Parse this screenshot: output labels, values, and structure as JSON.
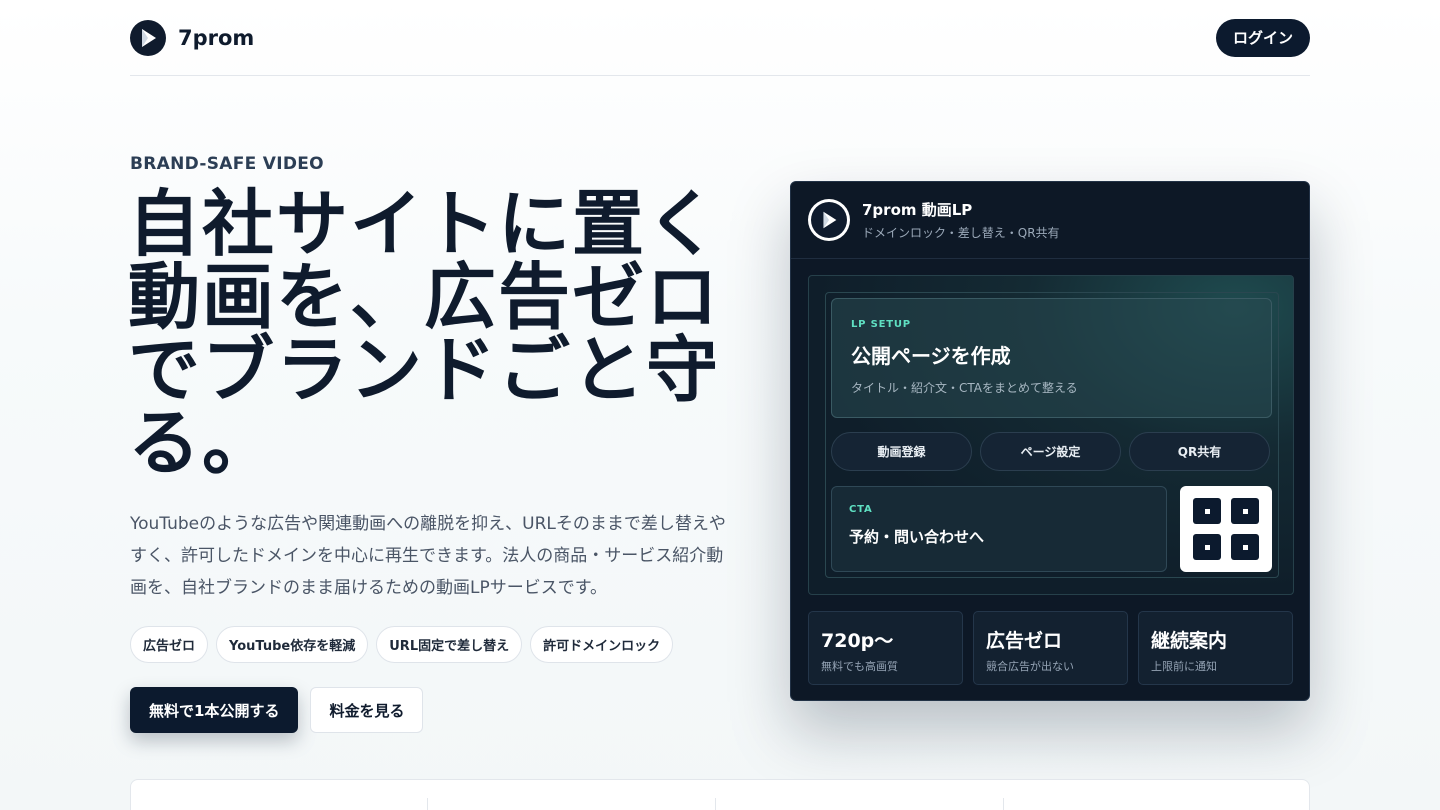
{
  "header": {
    "brand_name": "7prom",
    "login_label": "ログイン"
  },
  "hero": {
    "eyebrow": "BRAND-SAFE VIDEO",
    "title_lines": [
      "自社サイトに置く",
      "動画を、広告ゼロ",
      "でブランドごと守",
      "る。"
    ],
    "description": "YouTubeのような広告や関連動画への離脱を抑え、URLそのままで差し替えやすく、許可したドメインを中心に再生できます。法人の商品・サービス紹介動画を、自社ブランドのまま届けるための動画LPサービスです。",
    "chips": [
      "広告ゼロ",
      "YouTube依存を軽減",
      "URL固定で差し替え",
      "許可ドメインロック"
    ],
    "primary_cta": "無料で1本公開する",
    "secondary_cta": "料金を見る"
  },
  "panel": {
    "title": "7prom 動画LP",
    "subtitle": "ドメインロック・差し替え・QR共有",
    "setup": {
      "tag": "LP SETUP",
      "title": "公開ページを作成",
      "desc": "タイトル・紹介文・CTAをまとめて整える"
    },
    "pills": [
      "動画登録",
      "ページ設定",
      "QR共有"
    ],
    "cta": {
      "tag": "CTA",
      "label": "予約・問い合わせへ"
    },
    "stats": [
      {
        "value": "720p〜",
        "sub": "無料でも高画質"
      },
      {
        "value": "広告ゼロ",
        "sub": "競合広告が出ない"
      },
      {
        "value": "継続案内",
        "sub": "上限前に通知"
      }
    ]
  },
  "colors": {
    "navy": "#0c1a2e",
    "accent_teal": "#5fe0c2",
    "panel_bg": "#0d1826"
  }
}
